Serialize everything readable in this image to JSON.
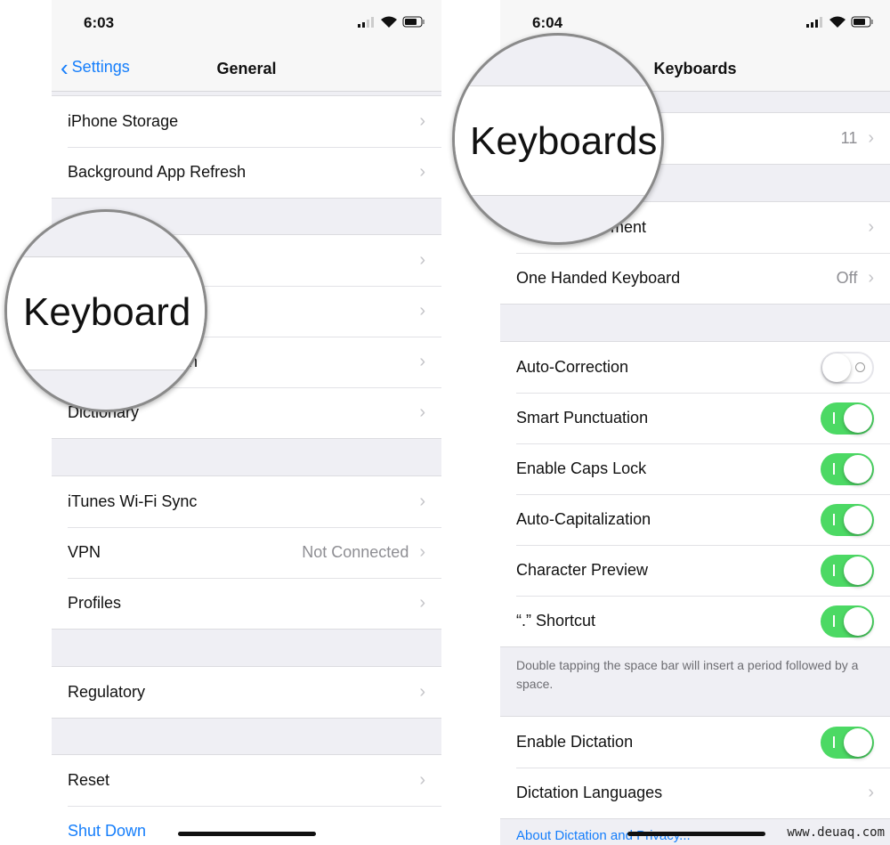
{
  "left": {
    "time": "6:03",
    "back_label": "Settings",
    "title": "General",
    "groups": [
      [
        {
          "label": "iPhone Storage"
        },
        {
          "label": "Background App Refresh"
        }
      ],
      [
        {
          "label": ""
        },
        {
          "label": ""
        },
        {
          "label": "gion"
        },
        {
          "label": "Dictionary"
        }
      ],
      [
        {
          "label": "iTunes Wi-Fi Sync"
        },
        {
          "label": "VPN",
          "value": "Not Connected"
        },
        {
          "label": "Profiles"
        }
      ],
      [
        {
          "label": "Regulatory"
        }
      ],
      [
        {
          "label": "Reset"
        }
      ]
    ],
    "shut_down": "Shut Down",
    "magnifier_text": "Keyboard"
  },
  "right": {
    "time": "6:04",
    "title": "Keyboards",
    "keyboards_value": "11",
    "text_replacement_partial": "ement",
    "one_handed": {
      "label": "One Handed Keyboard",
      "value": "Off"
    },
    "toggles": [
      {
        "label": "Auto-Correction",
        "on": false
      },
      {
        "label": "Smart Punctuation",
        "on": true
      },
      {
        "label": "Enable Caps Lock",
        "on": true
      },
      {
        "label": "Auto-Capitalization",
        "on": true
      },
      {
        "label": "Character Preview",
        "on": true
      },
      {
        "label": "“.” Shortcut",
        "on": true
      }
    ],
    "shortcut_footer": "Double tapping the space bar will insert a period followed by a space.",
    "enable_dictation": {
      "label": "Enable Dictation",
      "on": true
    },
    "dictation_languages": "Dictation Languages",
    "about_link": "About Dictation and Privacy...",
    "magnifier_text": "Keyboards"
  },
  "watermark": "www.deuaq.com",
  "colors": {
    "accent": "#157efb",
    "toggle_on": "#4cd964",
    "background": "#efeff4"
  }
}
